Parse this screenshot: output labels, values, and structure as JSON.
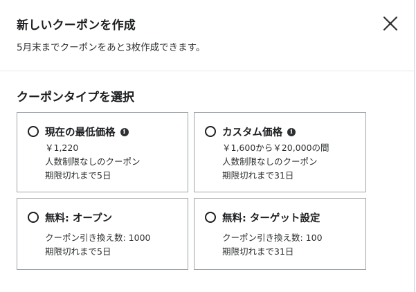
{
  "dialog": {
    "title": "新しいクーポンを作成",
    "subtitle": "5月末までクーポンをあと3枚作成できます。",
    "close_label": "×"
  },
  "section": {
    "title": "クーポンタイプを選択"
  },
  "options": [
    {
      "title": "現在の最低価格",
      "has_info": true,
      "lines": [
        "￥1,220",
        "人数制限なしのクーポン",
        "期限切れまで5日"
      ]
    },
    {
      "title": "カスタム価格",
      "has_info": true,
      "lines": [
        "￥1,600から￥20,000の間",
        "人数制限なしのクーポン",
        "期限切れまで31日"
      ]
    },
    {
      "title": "無料: オープン",
      "has_info": false,
      "lines": [
        "クーポン引き換え数: 1000",
        "期限切れまで5日"
      ]
    },
    {
      "title": "無料: ターゲット設定",
      "has_info": false,
      "lines": [
        "クーポン引き換え数: 100",
        "期限切れまで31日"
      ]
    }
  ],
  "icons": {
    "info": "info-icon",
    "close": "close-icon",
    "radio": "radio-unchecked-icon"
  }
}
